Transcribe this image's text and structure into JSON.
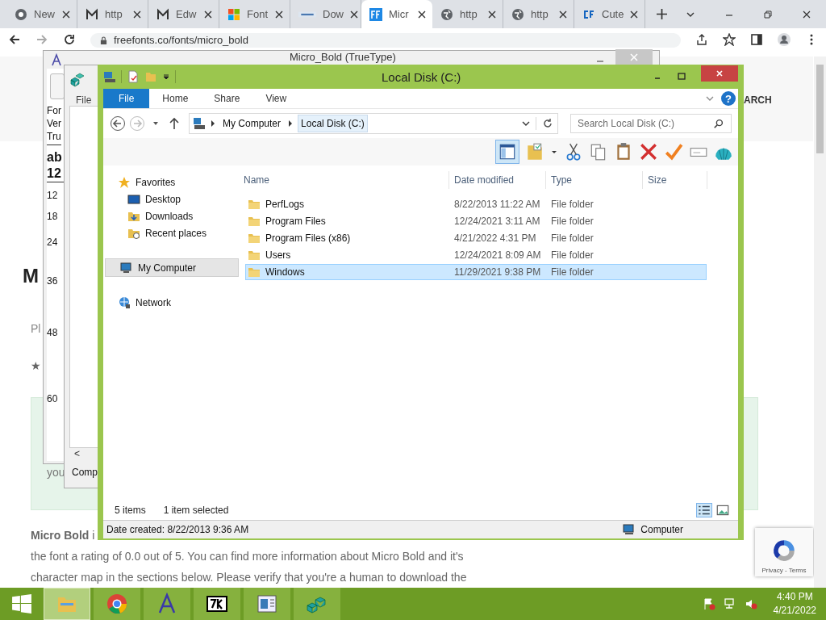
{
  "browser": {
    "tabs": [
      {
        "label": "New",
        "kind": "chrome",
        "selected": false
      },
      {
        "label": "http",
        "kind": "gmail",
        "selected": false
      },
      {
        "label": "Edw",
        "kind": "gmail",
        "selected": false
      },
      {
        "label": "Font",
        "kind": "windows",
        "selected": false
      },
      {
        "label": "Dow",
        "kind": "site",
        "selected": false
      },
      {
        "label": "Micr",
        "kind": "ff",
        "selected": true
      },
      {
        "label": "http",
        "kind": "globe",
        "selected": false
      },
      {
        "label": "http",
        "kind": "globe",
        "selected": false
      },
      {
        "label": "Cute",
        "kind": "cf",
        "selected": false
      }
    ],
    "url": "freefonts.co/fonts/micro_bold"
  },
  "page": {
    "search_label": "ARCH",
    "heading_fragment": "M",
    "fragment_pl": "Pl",
    "rating_star": "★",
    "fragment_you": "you",
    "intro": "**Micro Bold** i",
    "paragraph_lines": [
      "the font a rating of 0.0 out of 5. You can find more information about Micro Bold and it's",
      "character map in the sections below. Please verify that you're a human to download the"
    ],
    "recaptcha": "Privacy - Terms"
  },
  "font_viewer": {
    "title": "Micro_Bold (TrueType)",
    "info_lines": [
      "For",
      "Ver",
      "Tru"
    ],
    "sample_lines": [
      "ab",
      "12"
    ],
    "sizes": [
      "12",
      "18",
      "24",
      "36",
      "48",
      "60"
    ]
  },
  "back_window": {
    "menu": "File",
    "scroll_arrow": "<",
    "status": "Comp"
  },
  "explorer": {
    "title": "Local Disk (C:)",
    "ribbon_tabs": [
      {
        "label": "File",
        "selected": true
      },
      {
        "label": "Home",
        "selected": false
      },
      {
        "label": "Share",
        "selected": false
      },
      {
        "label": "View",
        "selected": false
      }
    ],
    "breadcrumb": [
      {
        "label": "My Computer",
        "selected": false
      },
      {
        "label": "Local Disk (C:)",
        "selected": true
      }
    ],
    "search_placeholder": "Search Local Disk (C:)",
    "help_label": "?",
    "nav": [
      {
        "label": "Favorites",
        "kind": "star",
        "selected": false,
        "children": [
          {
            "label": "Desktop",
            "kind": "desktop",
            "selected": false
          },
          {
            "label": "Downloads",
            "kind": "downloads",
            "selected": false
          },
          {
            "label": "Recent places",
            "kind": "recent",
            "selected": false
          }
        ]
      },
      {
        "label": "My Computer",
        "kind": "computer",
        "selected": true
      },
      {
        "label": "Network",
        "kind": "network",
        "selected": false
      }
    ],
    "columns": [
      "Name",
      "Date modified",
      "Type",
      "Size"
    ],
    "rows": [
      {
        "name": "PerfLogs",
        "date": "8/22/2013 11:22 AM",
        "type": "File folder",
        "selected": false
      },
      {
        "name": "Program Files",
        "date": "12/24/2021 3:11 AM",
        "type": "File folder",
        "selected": false
      },
      {
        "name": "Program Files (x86)",
        "date": "4/21/2022 4:31 PM",
        "type": "File folder",
        "selected": false
      },
      {
        "name": "Users",
        "date": "12/24/2021 8:09 AM",
        "type": "File folder",
        "selected": false
      },
      {
        "name": "Windows",
        "date": "11/29/2021 9:38 PM",
        "type": "File folder",
        "selected": true
      }
    ],
    "item_count": "5 items",
    "selection": "1 item selected",
    "details": "Date created: 8/22/2013 9:36 AM",
    "location": "Computer"
  },
  "taskbar": {
    "apps": [
      {
        "kind": "explorer",
        "selected": true
      },
      {
        "kind": "chrome",
        "selected": false
      },
      {
        "kind": "fontapp",
        "selected": false
      },
      {
        "kind": "zip",
        "selected": false
      },
      {
        "kind": "viewer",
        "selected": false
      },
      {
        "kind": "registry",
        "selected": false
      }
    ],
    "time": "4:40 PM",
    "date": "4/21/2022"
  }
}
